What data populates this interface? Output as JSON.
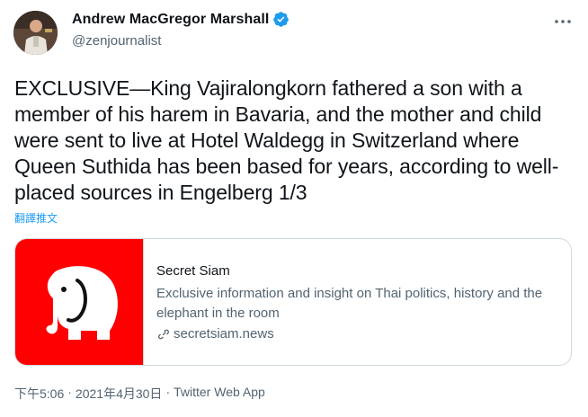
{
  "author": {
    "display_name": "Andrew MacGregor Marshall",
    "handle": "@zenjournalist",
    "verified": true,
    "avatar_icon": "profile-photo"
  },
  "tweet": {
    "text": "EXCLUSIVE—King Vajiralongkorn fathered a son with a member of his harem in Bavaria, and the mother and child were sent to live at Hotel Waldegg in Switzerland where Queen Suthida has been based for years, according to well-placed sources in Engelberg 1/3",
    "translate_label": "翻譯推文"
  },
  "card": {
    "site_name": "Secret Siam",
    "description": "Exclusive information and insight on Thai politics, history and the elephant in the room",
    "domain": "secretsiam.news",
    "thumbnail_icon": "elephant-icon",
    "thumbnail_bg": "#ff0000"
  },
  "meta": {
    "time": "下午5:06",
    "separator_1": "·",
    "date": "2021年4月30日",
    "separator_2": "·",
    "source": "Twitter Web App"
  },
  "colors": {
    "accent": "#1d9bf0",
    "secondary_text": "#536471",
    "border": "#cfd9de"
  }
}
